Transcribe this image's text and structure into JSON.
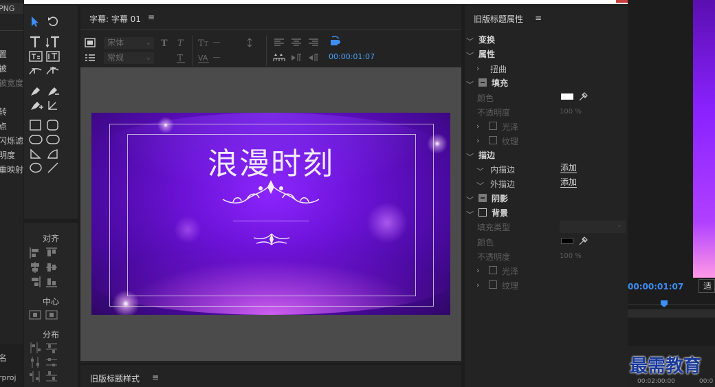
{
  "left_panel": {
    "rows": [
      "PNG",
      "置",
      "被",
      "被宽度",
      "转",
      "点",
      "闪烁滤",
      "明度",
      "重映射",
      "名",
      "rproj"
    ]
  },
  "tools_panel": {
    "sections": {
      "align": "对齐",
      "center": "中心",
      "distribute": "分布"
    }
  },
  "title_panel": {
    "tab_title": "字幕: 字幕 01",
    "menu_icon": "≡",
    "font_family": "宋体",
    "font_style": "常规",
    "timecode": "00:00:01:07",
    "title_text": "浪漫时刻"
  },
  "style_panel": {
    "title": "旧版标题样式",
    "menu_icon": "≡"
  },
  "properties_panel": {
    "title": "旧版标题属性",
    "menu_icon": "≡",
    "transform": "变换",
    "properties": "属性",
    "distort": "扭曲",
    "fill": "填充",
    "color": "颜色",
    "opacity": "不透明度",
    "opacity_value": "100 %",
    "sheen": "光泽",
    "texture": "纹理",
    "strokes": "描边",
    "inner_stroke": "内描边",
    "outer_stroke": "外描边",
    "add": "添加",
    "shadow": "阴影",
    "background": "背景",
    "fill_type": "填充类型",
    "bg_color": "颜色",
    "bg_opacity": "不透明度",
    "bg_opacity_value": "100 %",
    "bg_sheen": "光泽",
    "bg_texture": "纹理",
    "fill_color_hex": "#ffffff",
    "bg_color_hex": "#000000"
  },
  "program_panel": {
    "timecode": "00:00:01:07",
    "fit": "适",
    "ruler_time_a": "00:02:00:00",
    "ruler_time_b": "00:0"
  },
  "watermark": "最需教育"
}
